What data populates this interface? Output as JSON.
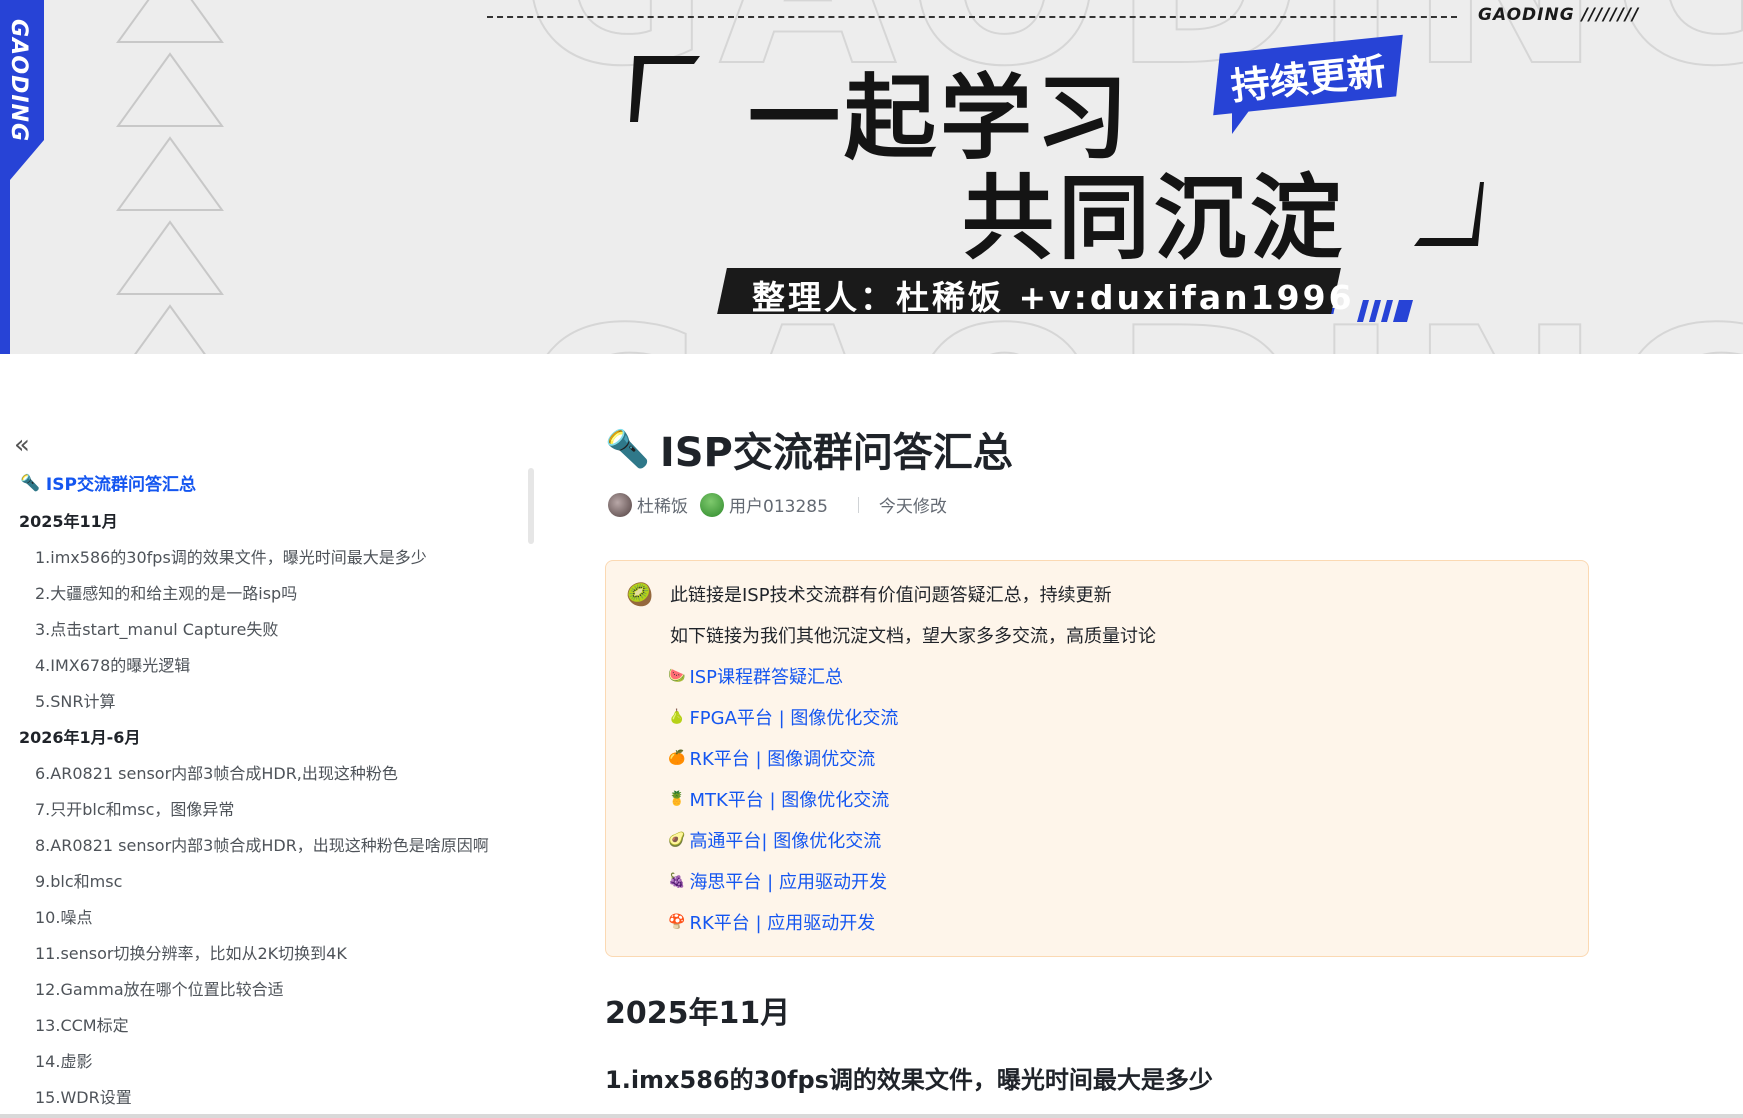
{
  "banner": {
    "vertical_brand": "GAODING",
    "brand_top": "GAODING ////////",
    "title_line1": "一起学习",
    "title_line2": "共同沉淀",
    "badge": "持续更新",
    "author": "整理人：杜稀饭 +v:duxifan1996",
    "accent_color": "#2743d6"
  },
  "sidebar": {
    "collapse_icon": "«",
    "title_emoji": "🔦",
    "title": "ISP交流群问答汇总",
    "items": [
      {
        "type": "section",
        "label": "2025年11月"
      },
      {
        "type": "item",
        "label": "1.imx586的30fps调的效果文件，曝光时间最大是多少"
      },
      {
        "type": "item",
        "label": "2.大疆感知的和给主观的是一路isp吗"
      },
      {
        "type": "item",
        "label": "3.点击start_manul Capture失败"
      },
      {
        "type": "item",
        "label": "4.IMX678的曝光逻辑"
      },
      {
        "type": "item",
        "label": "5.SNR计算"
      },
      {
        "type": "section",
        "label": "2026年1月-6月"
      },
      {
        "type": "item",
        "label": "6.AR0821 sensor内部3帧合成HDR,出现这种粉色"
      },
      {
        "type": "item",
        "label": "7.只开blc和msc，图像异常"
      },
      {
        "type": "item",
        "label": "8.AR0821 sensor内部3帧合成HDR，出现这种粉色是啥原因啊"
      },
      {
        "type": "item",
        "label": "9.blc和msc"
      },
      {
        "type": "item",
        "label": "10.噪点"
      },
      {
        "type": "item",
        "label": "11.sensor切换分辨率，比如从2K切换到4K"
      },
      {
        "type": "item",
        "label": "12.Gamma放在哪个位置比较合适"
      },
      {
        "type": "item",
        "label": "13.CCM标定"
      },
      {
        "type": "item",
        "label": "14.虚影"
      },
      {
        "type": "item",
        "label": "15.WDR设置"
      }
    ]
  },
  "doc": {
    "title_emoji": "🔦",
    "title": "ISP交流群问答汇总",
    "meta": {
      "author1": "杜稀饭",
      "author2": "用户013285",
      "modified": "今天修改"
    },
    "callout": {
      "icon": "🥝",
      "line1": "此链接是ISP技术交流群有价值问题答疑汇总，持续更新",
      "line2": "如下链接为我们其他沉淀文档，望大家多多交流，高质量讨论",
      "links": [
        {
          "icon": "🍉",
          "label": "ISP课程群答疑汇总"
        },
        {
          "icon": "🍐",
          "label": "FPGA平台 | 图像优化交流"
        },
        {
          "icon": "🍊",
          "label": "RK平台 | 图像调优交流"
        },
        {
          "icon": "🍍",
          "label": "MTK平台 | 图像优化交流"
        },
        {
          "icon": "🥑",
          "label": "高通平台| 图像优化交流"
        },
        {
          "icon": "🍇",
          "label": "海思平台 | 应用驱动开发"
        },
        {
          "icon": "🍄",
          "label": "RK平台 | 应用驱动开发"
        }
      ]
    },
    "h1": "2025年11月",
    "h2": "1.imx586的30fps调的效果文件，曝光时间最大是多少"
  }
}
